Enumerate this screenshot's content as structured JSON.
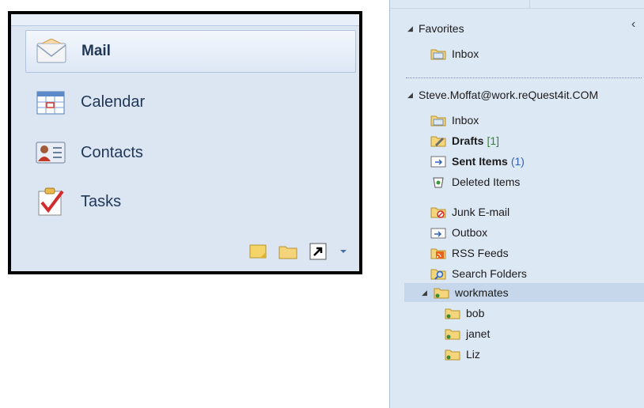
{
  "nav": {
    "items": [
      {
        "label": "Mail",
        "icon": "mail-envelope-icon"
      },
      {
        "label": "Calendar",
        "icon": "calendar-icon"
      },
      {
        "label": "Contacts",
        "icon": "contacts-card-icon"
      },
      {
        "label": "Tasks",
        "icon": "tasks-checkmark-icon"
      }
    ],
    "bottom_icons": [
      "notes-icon",
      "folder-list-icon",
      "shortcuts-icon",
      "configure-buttons-arrow-icon"
    ]
  },
  "folders": {
    "favorites_label": "Favorites",
    "favorites": [
      {
        "label": "Inbox"
      }
    ],
    "account_label": "Steve.Moffat@work.reQuest4it.COM",
    "account_folders": [
      {
        "label": "Inbox"
      },
      {
        "label": "Drafts",
        "count": "[1]"
      },
      {
        "label": "Sent Items",
        "count": "(1)"
      },
      {
        "label": "Deleted Items"
      },
      {
        "label": "Junk E-mail"
      },
      {
        "label": "Outbox"
      },
      {
        "label": "RSS Feeds"
      },
      {
        "label": "Search Folders"
      },
      {
        "label": "workmates"
      }
    ],
    "workmates_children": [
      {
        "label": "bob"
      },
      {
        "label": "janet"
      },
      {
        "label": "Liz"
      }
    ]
  },
  "colors": {
    "pane_bg": "#dde8f5",
    "selected": "#c6d7ec",
    "text_dark": "#1f3656"
  }
}
